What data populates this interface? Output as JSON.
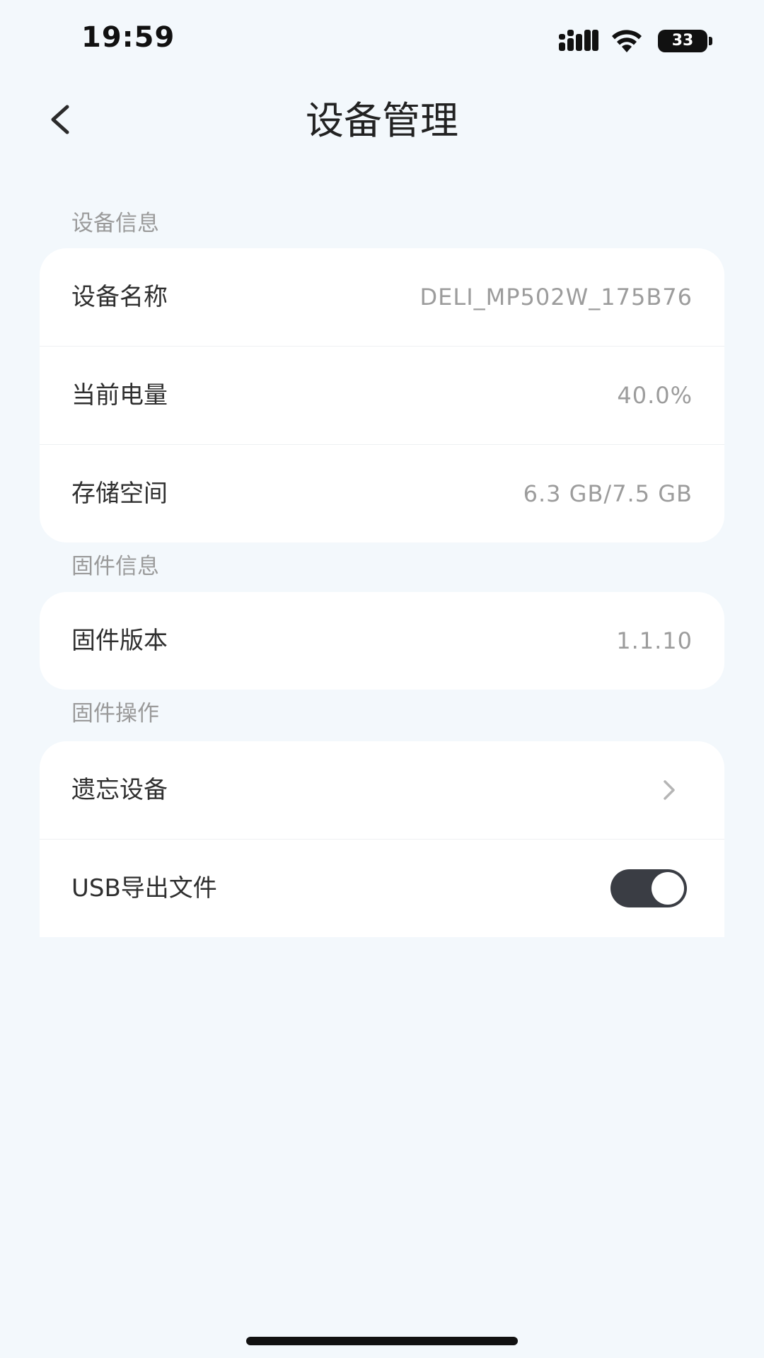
{
  "status_bar": {
    "time": "19:59",
    "battery_level": "33",
    "icons": [
      "cellular-signal-icon",
      "wifi-icon",
      "battery-icon"
    ]
  },
  "nav": {
    "title": "设备管理",
    "back_icon": "chevron-left-icon"
  },
  "sections": {
    "device_info": {
      "header": "设备信息",
      "rows": [
        {
          "label": "设备名称",
          "value": "DELI_MP502W_175B76"
        },
        {
          "label": "当前电量",
          "value": "40.0%"
        },
        {
          "label": "存储空间",
          "value": "6.3 GB/7.5 GB"
        }
      ]
    },
    "firmware_info": {
      "header": "固件信息",
      "rows": [
        {
          "label": "固件版本",
          "value": "1.1.10"
        }
      ]
    },
    "firmware_ops": {
      "header": "固件操作",
      "rows": [
        {
          "label": "遗忘设备",
          "icon": "chevron-right-icon"
        },
        {
          "label": "USB导出文件",
          "toggle_on": true
        }
      ]
    }
  },
  "colors": {
    "background": "#f3f8fc",
    "card": "#ffffff",
    "toggle_on": "#3a3d44",
    "secondary_text": "#9c9c9c"
  }
}
